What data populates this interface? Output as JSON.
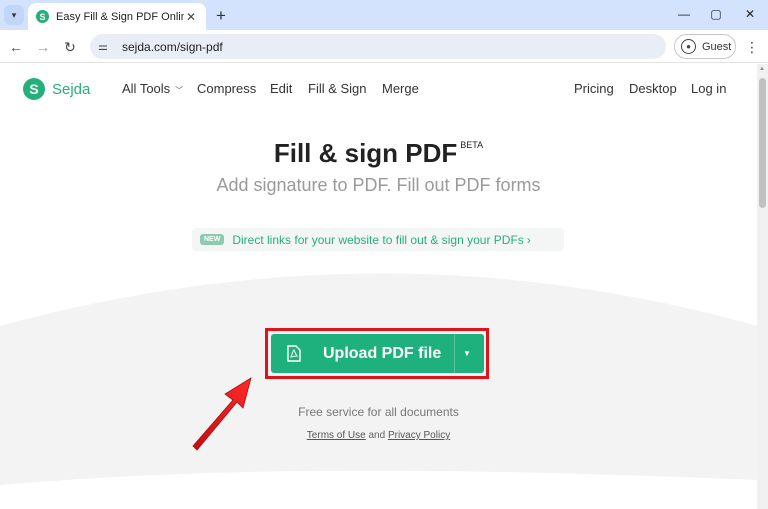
{
  "browser": {
    "tab_title": "Easy Fill & Sign PDF Online",
    "tab_favicon": "S",
    "tab_close": "✕",
    "new_tab": "+",
    "url": "sejda.com/sign-pdf",
    "profile_label": "Guest",
    "icons": {
      "tab_search": "chevron-down-icon",
      "back": "arrow-left-icon",
      "forward": "arrow-right-icon",
      "reload": "reload-icon",
      "site_info": "tune-icon",
      "profile": "person-icon",
      "menu": "kebab-icon",
      "minimize": "minimize-icon",
      "maximize": "maximize-icon",
      "close": "close-icon"
    },
    "tab_bg": "#d3e3fd"
  },
  "site": {
    "logo_mark": "S",
    "logo_text": "Sejda",
    "brand_color": "#25b07a",
    "nav_left": [
      {
        "label": "All Tools"
      },
      {
        "label": "Compress"
      },
      {
        "label": "Edit"
      },
      {
        "label": "Fill & Sign"
      },
      {
        "label": "Merge"
      }
    ],
    "nav_right": [
      {
        "label": "Pricing"
      },
      {
        "label": "Desktop"
      },
      {
        "label": "Log in"
      }
    ]
  },
  "hero": {
    "title": "Fill & sign PDF",
    "badge": "BETA",
    "subtitle": "Add signature to PDF. Fill out PDF forms"
  },
  "promo": {
    "badge": "NEW",
    "text": "Direct links for your website to fill out & sign your PDFs",
    "chevron": "›"
  },
  "upload": {
    "label": "Upload PDF file",
    "button_color": "#1fb17d",
    "highlight_color": "#e1131a"
  },
  "footer": {
    "free_text": "Free service for all documents",
    "terms": "Terms of Use",
    "and": "and",
    "privacy": "Privacy Policy"
  }
}
